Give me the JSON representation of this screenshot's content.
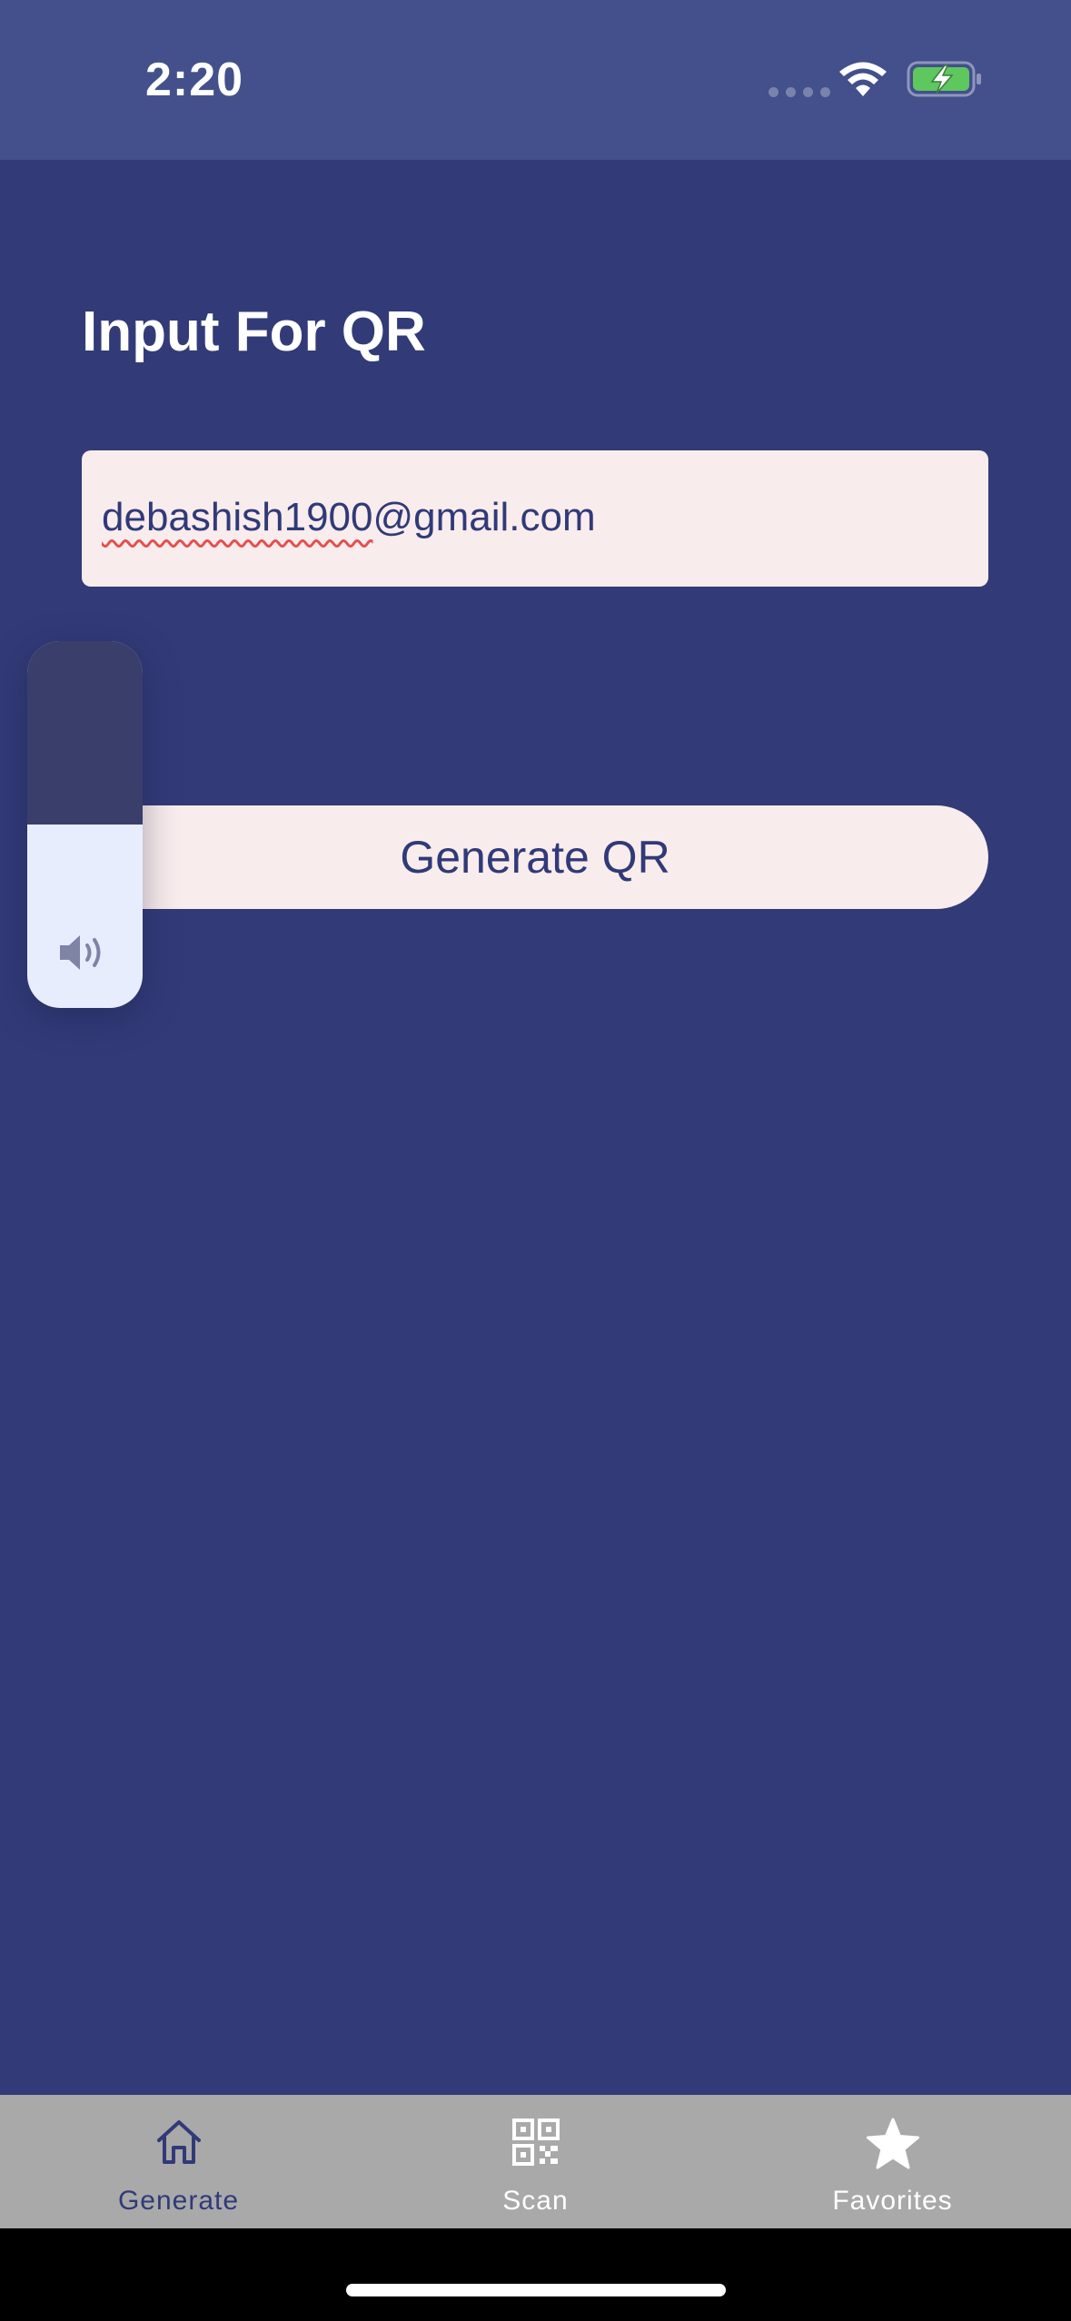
{
  "status_bar": {
    "time": "2:20",
    "icons": [
      "cellular-dots-icon",
      "wifi-icon",
      "battery-charging-icon"
    ],
    "battery_color": "#5ec75e"
  },
  "main": {
    "title": "Input For QR",
    "input": {
      "value": "debashish1900@gmail.com",
      "misspelled_part": "debashish1900",
      "rest": "@gmail.com"
    },
    "generate_button_label": "Generate QR"
  },
  "volume_hud": {
    "level_percent": 50,
    "icon": "speaker-volume-icon"
  },
  "tab_bar": {
    "tabs": [
      {
        "label": "Generate",
        "icon": "home-icon",
        "active": true
      },
      {
        "label": "Scan",
        "icon": "qr-code-icon",
        "active": false
      },
      {
        "label": "Favorites",
        "icon": "star-icon",
        "active": false
      }
    ]
  },
  "colors": {
    "background": "#323b78",
    "status_bar": "#43508b",
    "field": "#f9ecec",
    "accent_text": "#313a78",
    "tab_bar": "#a9a9a9"
  }
}
